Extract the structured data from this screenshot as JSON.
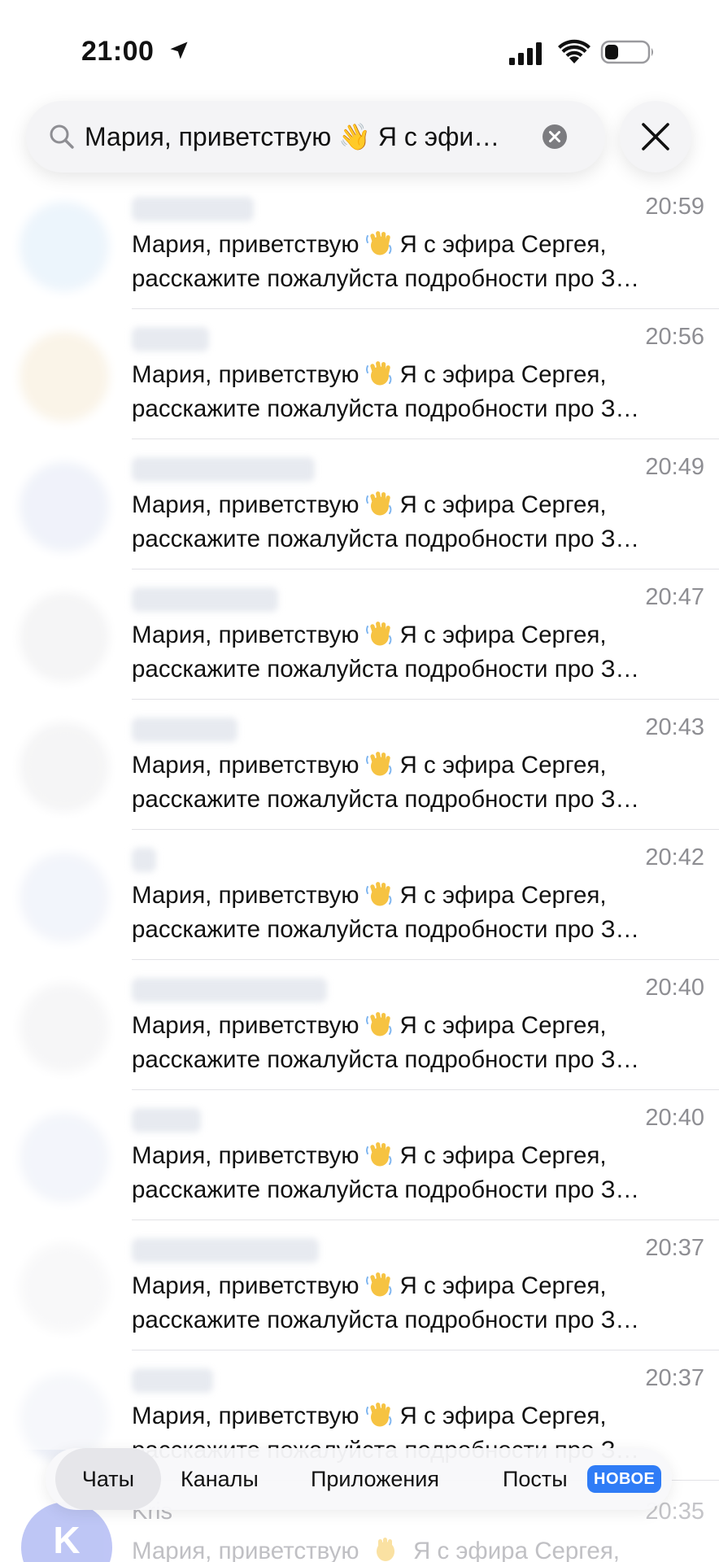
{
  "status_bar": {
    "time": "21:00",
    "icons": [
      "location-arrow-icon",
      "cellular-signal-icon",
      "wifi-icon",
      "battery-icon"
    ]
  },
  "search": {
    "query": "Мария, приветствую 👋 Я с эфи…",
    "clear_icon": "clear-circle-icon",
    "close_icon": "close-icon"
  },
  "results": [
    {
      "time": "20:59",
      "line1_before": "Мария, приветствую",
      "line1_after": "Я с эфира Сергея,",
      "line2": "расскажите пожалуйста подробности про З…",
      "avatar_color": "#d6e8f8"
    },
    {
      "time": "20:56",
      "line1_before": "Мария, приветствую",
      "line1_after": "Я с эфира Сергея,",
      "line2": "расскажите пожалуйста подробности про З…",
      "avatar_color": "#f4e6cc"
    },
    {
      "time": "20:49",
      "line1_before": "Мария, приветствую",
      "line1_after": "Я с эфира Сергея,",
      "line2": "расскажите пожалуйста подробности про З…",
      "avatar_color": "#dde3f3"
    },
    {
      "time": "20:47",
      "line1_before": "Мария, приветствую",
      "line1_after": "Я с эфира Сергея,",
      "line2": "расскажите пожалуйста подробности про З…",
      "avatar_color": "#e8e8ea"
    },
    {
      "time": "20:43",
      "line1_before": "Мария, приветствую",
      "line1_after": "Я с эфира Сергея,",
      "line2": "расскажите пожалуйста подробности про З…",
      "avatar_color": "#e9e9eb"
    },
    {
      "time": "20:42",
      "line1_before": "Мария, приветствую",
      "line1_after": "Я с эфира Сергея,",
      "line2": "расскажите пожалуйста подробности про З…",
      "avatar_color": "#e3e8f5"
    },
    {
      "time": "20:40",
      "line1_before": "Мария, приветствую",
      "line1_after": "Я с эфира Сергея,",
      "line2": "расскажите пожалуйста подробности про З…",
      "avatar_color": "#ececee"
    },
    {
      "time": "20:40",
      "line1_before": "Мария, приветствую",
      "line1_after": "Я с эфира Сергея,",
      "line2": "расскажите пожалуйста подробности про З…",
      "avatar_color": "#e4e9f5"
    },
    {
      "time": "20:37",
      "line1_before": "Мария, приветствую",
      "line1_after": "Я с эфира Сергея,",
      "line2": "расскажите пожалуйста подробности про З…",
      "avatar_color": "#f0f0f2"
    },
    {
      "time": "20:37",
      "line1_before": "Мария, приветствую",
      "line1_after": "Я с эфира Сергея,",
      "line2": "расскажите пожалуйста подробности про З…",
      "avatar_color": "#ebeef6"
    }
  ],
  "tabs": [
    {
      "label": "Чаты",
      "active": true
    },
    {
      "label": "Каналы",
      "active": false
    },
    {
      "label": "Приложения",
      "active": false
    },
    {
      "label": "Посты",
      "active": false,
      "badge": "НОВОЕ"
    }
  ],
  "bottom_row": {
    "avatar_letter": "K",
    "name": "Kris",
    "time": "20:35",
    "preview_before": "Мария, приветствую",
    "preview_after": "Я с эфира Сергея,"
  },
  "colors": {
    "accent": "#2f7cf6",
    "time_gray": "#8e8e93",
    "divider": "#e2e2e6"
  }
}
